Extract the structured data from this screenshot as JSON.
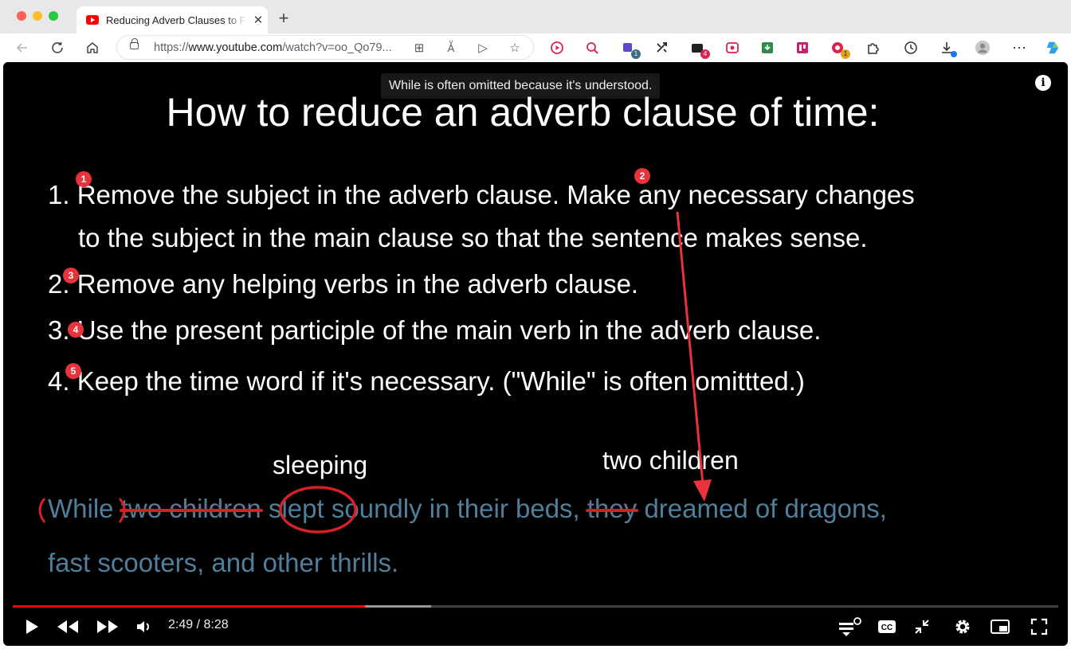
{
  "browser": {
    "tab_title": "Reducing Adverb Clauses to Phrases",
    "url_prefix": "https://",
    "url_host": "www.youtube.com",
    "url_rest": "/watch?v=oo_Qo79...",
    "new_tab": "+",
    "tab_close": "✕",
    "extension_badges": {
      "ext3": "1",
      "ext5": "4",
      "ext10": "1"
    }
  },
  "video": {
    "tooltip": "While is often omitted because it's understood.",
    "info_symbol": "i",
    "slide_title": "How to reduce an adverb clause of time:",
    "steps": {
      "s1a": "1. Remove the subject in the adverb clause.  Make any necessary changes",
      "s1b": "to the subject in the main clause so that the sentence makes sense.",
      "s2": "2. Remove any helping verbs in the adverb clause.",
      "s3": "3. Use the present participle of the main verb in the adverb clause.",
      "s4": "4. Keep the time word if it's necessary. (\"While\" is often omittted.)"
    },
    "markers": [
      "1",
      "2",
      "3",
      "4",
      "5"
    ],
    "above_words": {
      "sleeping": "sleeping",
      "two_children": "two children"
    },
    "sentence": {
      "w_while": "While",
      "w_two_children": "two children",
      "w_slept": "slept",
      "w_mid": "soundly in their beds,",
      "w_they": "they",
      "w_end": "dreamed of dragons,",
      "line2": "fast scooters, and other thrills."
    },
    "accent_color": "#d42127",
    "sentence_color": "#4f7f9b"
  },
  "player": {
    "time": "2:49 / 8:28",
    "played_fraction": 0.337,
    "loaded_fraction": 0.4
  }
}
